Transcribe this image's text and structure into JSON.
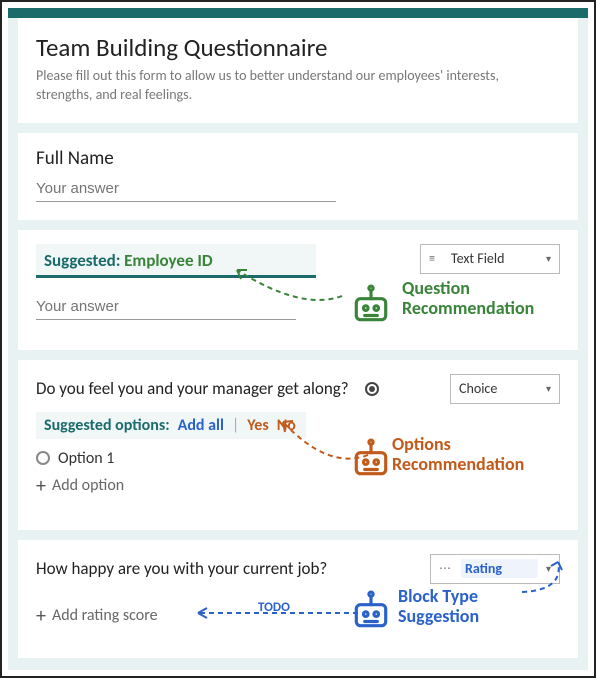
{
  "header": {
    "title": "Team Building Questionnaire",
    "subtitle": "Please fill out this form to allow us to better understand our employees' interests, strengths, and real feelings."
  },
  "q1": {
    "label": "Full Name",
    "placeholder": "Your answer"
  },
  "q2": {
    "suggested_prefix": "Suggested:",
    "suggested_value": "Employee ID",
    "type_label": "Text Field",
    "placeholder": "Your answer",
    "annot_line1": "Question",
    "annot_line2": "Recommendation"
  },
  "q3": {
    "text": "Do you feel you and your manager get along?",
    "type_label": "Choice",
    "sugg_label": "Suggested options:",
    "add_all": "Add all",
    "opts": {
      "a": "Yes",
      "b": "No"
    },
    "option1": "Option 1",
    "add_option": "Add option",
    "annot_line1": "Options",
    "annot_line2": "Recommendation"
  },
  "q4": {
    "text": "How happy are you with your current job?",
    "type_label": "Rating",
    "add_rating": "Add rating score",
    "todo": "TODO",
    "annot_line1": "Block Type",
    "annot_line2": "Suggestion"
  }
}
